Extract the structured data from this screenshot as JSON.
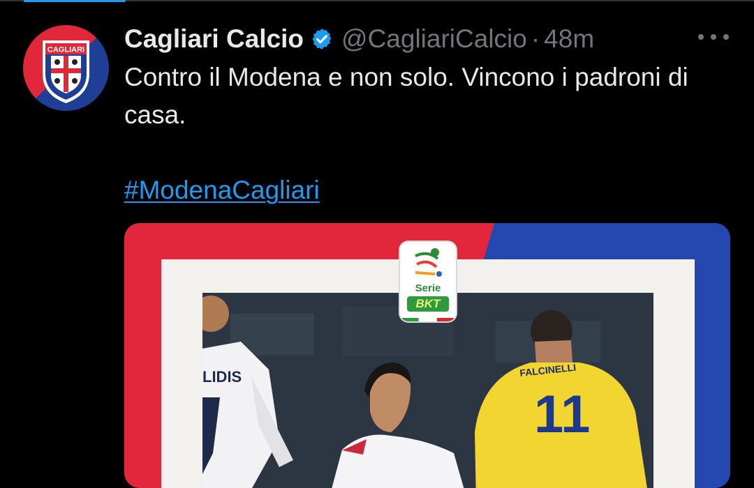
{
  "tweet": {
    "author_name": "Cagliari Calcio",
    "handle": "@CagliariCalcio",
    "separator": "·",
    "time": "48m",
    "text": "Contro il Modena e non solo. Vincono i padroni di casa.",
    "hashtag": "#ModenaCagliari",
    "avatar_text": "CAGLIARI"
  },
  "media": {
    "league_logo_text": "Serie",
    "league_brand": "BKT",
    "player_left_name": "LIDIS",
    "player_right_name": "FALCINELLI",
    "player_right_number": "11"
  },
  "colors": {
    "accent": "#1d9bf0",
    "brand_red": "#e2263b",
    "brand_blue": "#2547b0",
    "yellow_kit": "#f2d530"
  },
  "icons": {
    "verified": "verified-badge-icon",
    "more": "more-options-icon"
  }
}
